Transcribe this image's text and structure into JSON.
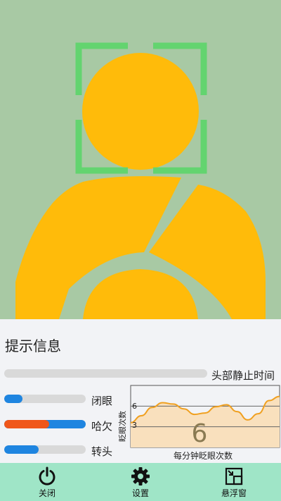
{
  "camera": {
    "background_color": "#a8c9a4",
    "face_frame_color": "#63d46f",
    "silhouette_color": "#ffbb0a"
  },
  "panel": {
    "title": "提示信息",
    "head_still": {
      "label": "头部静止时间",
      "progress": 0.0
    },
    "indicators": [
      {
        "label": "闭眼",
        "progress": 0.22,
        "color": "#1f85e0"
      },
      {
        "label": "哈欠",
        "progress": 0.55,
        "split_color": "#f0571a",
        "color": "#1f85e0"
      },
      {
        "label": "转头",
        "progress": 0.42,
        "color": "#1f85e0"
      }
    ]
  },
  "chart_data": {
    "type": "area",
    "title": "",
    "xlabel": "每分钟眨眼次数",
    "ylabel": "眨眼次数",
    "yticks": [
      "6",
      "3"
    ],
    "current_value": "6",
    "ylim": [
      0,
      9
    ],
    "values": [
      3.6,
      4.6,
      5.8,
      6.5,
      6.3,
      5.6,
      4.8,
      5.0,
      5.9,
      6.2,
      5.2,
      4.0,
      4.9,
      6.8,
      7.4
    ],
    "line_color": "#f0a020",
    "fill_color": "#f9e0bd"
  },
  "nav": {
    "items": [
      {
        "label": "关闭",
        "icon": "power-icon"
      },
      {
        "label": "设置",
        "icon": "gear-icon"
      },
      {
        "label": "悬浮窗",
        "icon": "floating-window-icon"
      }
    ]
  }
}
